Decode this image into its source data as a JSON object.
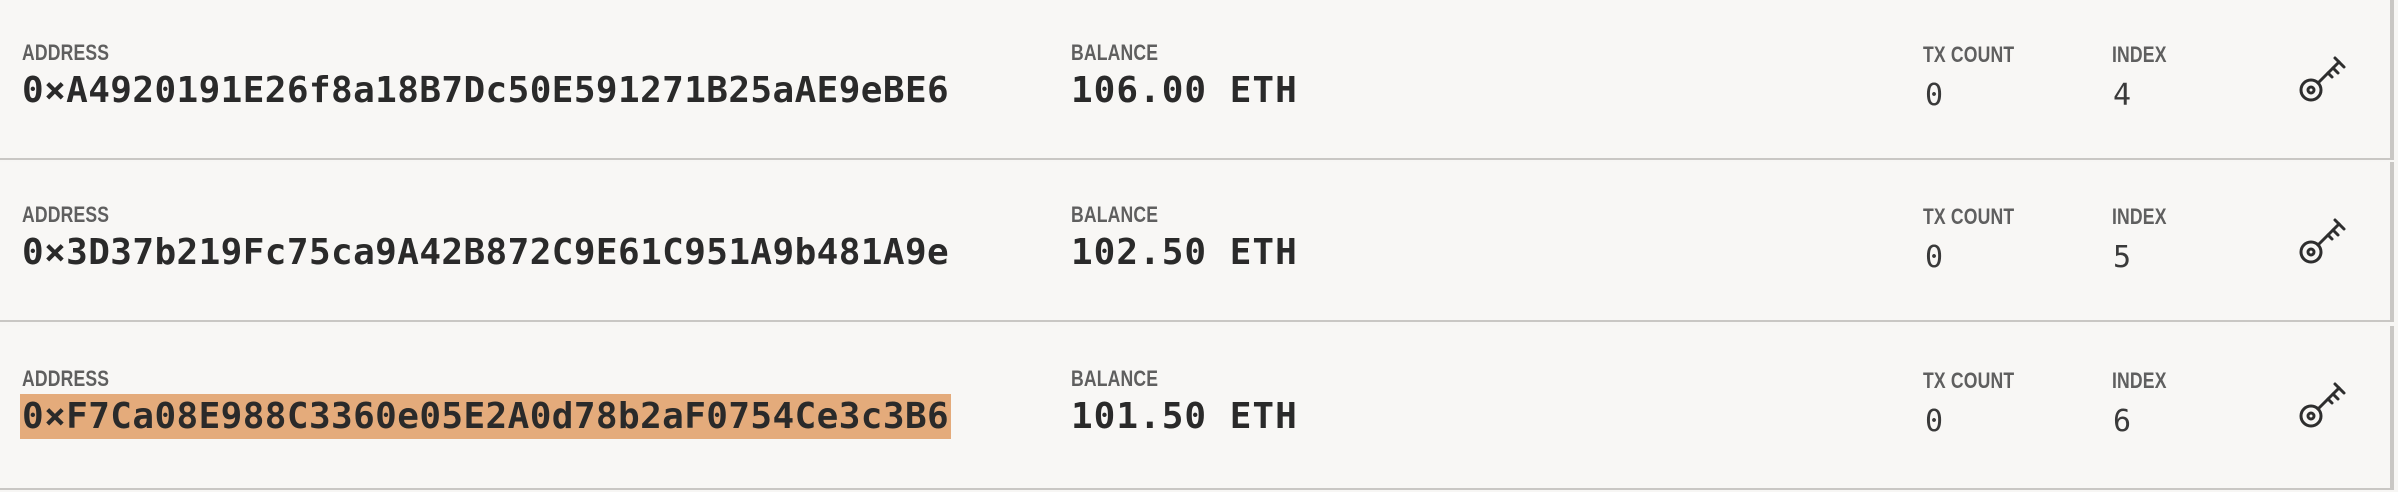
{
  "labels": {
    "address": "ADDRESS",
    "balance": "BALANCE",
    "tx_count": "TX COUNT",
    "index": "INDEX"
  },
  "accounts": [
    {
      "address": "0×A4920191E26f8a18B7Dc50E591271B25aAE9eBE6",
      "balance": "106.00  ETH",
      "tx_count": "0",
      "index": "4",
      "highlighted": false
    },
    {
      "address": "0×3D37b219Fc75ca9A42B872C9E61C951A9b481A9e",
      "balance": "102.50  ETH",
      "tx_count": "0",
      "index": "5",
      "highlighted": false
    },
    {
      "address": "0×F7Ca08E988C3360e05E2A0d78b2aF0754Ce3c3B6",
      "balance": "101.50  ETH",
      "tx_count": "0",
      "index": "6",
      "highlighted": true
    }
  ],
  "icons": {
    "key": "key-icon"
  },
  "colors": {
    "highlight": "#e4ab7b",
    "background": "#f8f7f5",
    "divider": "#c9c7c4"
  }
}
